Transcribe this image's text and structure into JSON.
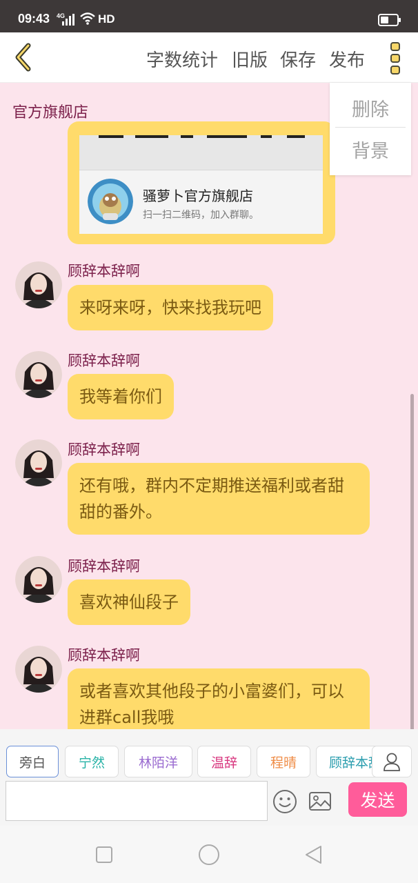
{
  "status_bar": {
    "time": "09:43",
    "network": "4G",
    "hd": "HD",
    "icons": [
      "signal-icon",
      "wifi-icon",
      "battery-icon"
    ]
  },
  "header": {
    "back_icon": "chevron-left-icon",
    "actions": {
      "word_count": "字数统计",
      "old_version": "旧版",
      "save": "保存",
      "publish": "发布"
    },
    "more_icon": "more-vertical-icon"
  },
  "dropdown_menu": {
    "delete": "删除",
    "background": "背景"
  },
  "chat": {
    "title": "官方旗舰店",
    "card": {
      "group_name": "骚萝卜官方旗舰店",
      "description": "扫一扫二维码，加入群聊。"
    },
    "messages": [
      {
        "sender": "顾辞本辞啊",
        "text": "来呀来呀，快来找我玩吧"
      },
      {
        "sender": "顾辞本辞啊",
        "text": "我等着你们"
      },
      {
        "sender": "顾辞本辞啊",
        "text": "还有哦，群内不定期推送福利或者甜甜的番外。"
      },
      {
        "sender": "顾辞本辞啊",
        "text": "喜欢神仙段子"
      },
      {
        "sender": "顾辞本辞啊",
        "text": "或者喜欢其他段子的小富婆们，可以进群call我哦"
      }
    ]
  },
  "roles": [
    {
      "label": "旁白",
      "color": "#555555",
      "active": true
    },
    {
      "label": "宁然",
      "color": "#26b2a6",
      "active": false
    },
    {
      "label": "林陌洋",
      "color": "#9a6bd0",
      "active": false
    },
    {
      "label": "温辞",
      "color": "#d8377f",
      "active": false
    },
    {
      "label": "程晴",
      "color": "#ef8c46",
      "active": false
    },
    {
      "label": "顾辞本辞啊",
      "color": "#2a9dae",
      "active": false
    }
  ],
  "composer": {
    "input_value": "",
    "send_label": "发送",
    "icons": [
      "person-icon",
      "emoji-icon",
      "image-icon"
    ]
  },
  "colors": {
    "bubble": "#ffdb6b",
    "chat_background": "#fce4ec",
    "sender_name": "#7b1f4a",
    "send_button": "#ff5c9a"
  },
  "nav_bar": {
    "icons": [
      "square-icon",
      "circle-icon",
      "back-triangle-icon"
    ]
  }
}
